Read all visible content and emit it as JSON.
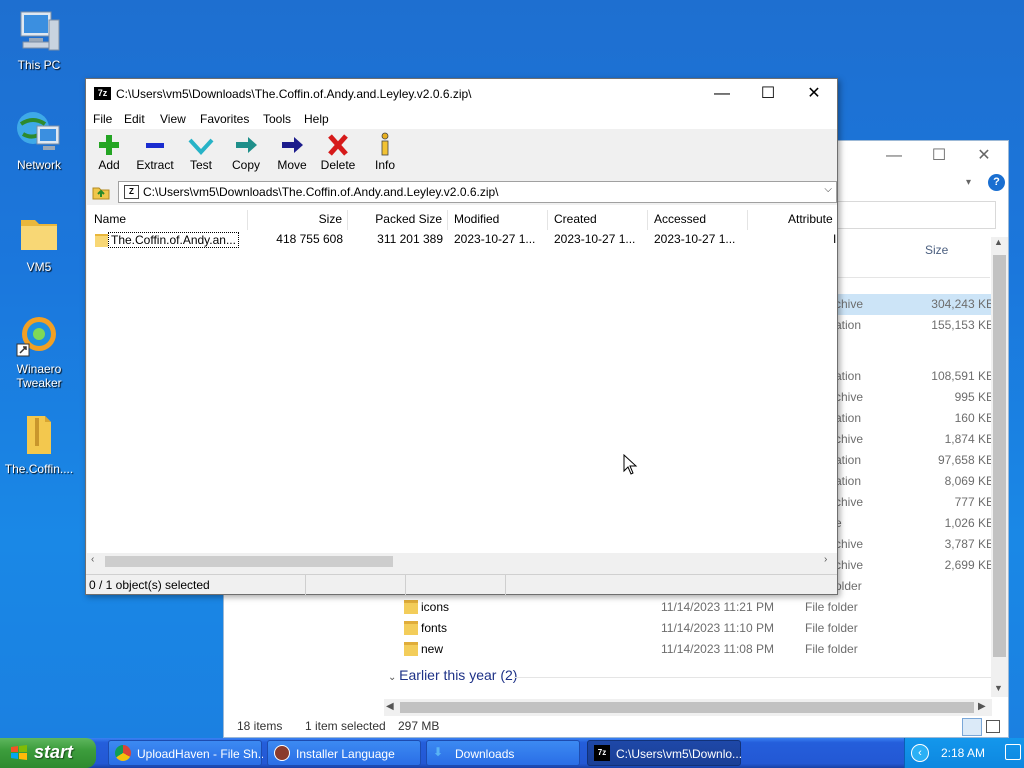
{
  "desktop": {
    "icons": [
      {
        "label": "This PC",
        "icon": "this-pc-icon"
      },
      {
        "label": "Network",
        "icon": "network-icon"
      },
      {
        "label": "VM5",
        "icon": "folder-icon"
      },
      {
        "label": "Winaero Tweaker",
        "icon": "winaero-tweaker-icon"
      },
      {
        "label": "The.Coffin....",
        "icon": "zip-folder-icon"
      }
    ]
  },
  "explorer": {
    "column_size": "Size",
    "rows": [
      {
        "type": "chive",
        "size": "304,243 KB",
        "selected": true
      },
      {
        "type": "ation",
        "size": "155,153 KB"
      },
      {
        "type": "ation",
        "size": "108,591 KB"
      },
      {
        "type": "chive",
        "size": "995 KB"
      },
      {
        "type": "ation",
        "size": "160 KB"
      },
      {
        "type": "chive",
        "size": "1,874 KB"
      },
      {
        "type": "ation",
        "size": "97,658 KB"
      },
      {
        "type": "ation",
        "size": "8,069 KB"
      },
      {
        "type": "chive",
        "size": "777 KB"
      },
      {
        "type": "e",
        "size": "1,026 KB"
      },
      {
        "type": "chive",
        "size": "3,787 KB"
      },
      {
        "type": "chive",
        "size": "2,699 KB"
      },
      {
        "type": "older",
        "size": ""
      }
    ],
    "folders": [
      {
        "name": "icons",
        "date": "11/14/2023 11:21 PM",
        "type": "File folder"
      },
      {
        "name": "fonts",
        "date": "11/14/2023 11:10 PM",
        "type": "File folder"
      },
      {
        "name": "new",
        "date": "11/14/2023 11:08 PM",
        "type": "File folder"
      }
    ],
    "group_header": "Earlier this year (2)",
    "status": {
      "items": "18 items",
      "selected": "1 item selected",
      "size": "297 MB"
    }
  },
  "zip": {
    "title": "C:\\Users\\vm5\\Downloads\\The.Coffin.of.Andy.and.Leyley.v2.0.6.zip\\",
    "menu": [
      "File",
      "Edit",
      "View",
      "Favorites",
      "Tools",
      "Help"
    ],
    "toolbar": [
      {
        "label": "Add",
        "icon": "add-icon"
      },
      {
        "label": "Extract",
        "icon": "extract-icon"
      },
      {
        "label": "Test",
        "icon": "test-icon"
      },
      {
        "label": "Copy",
        "icon": "copy-icon"
      },
      {
        "label": "Move",
        "icon": "move-icon"
      },
      {
        "label": "Delete",
        "icon": "delete-icon"
      },
      {
        "label": "Info",
        "icon": "info-icon"
      }
    ],
    "address": "C:\\Users\\vm5\\Downloads\\The.Coffin.of.Andy.and.Leyley.v2.0.6.zip\\",
    "columns": [
      "Name",
      "Size",
      "Packed Size",
      "Modified",
      "Created",
      "Accessed",
      "Attribute"
    ],
    "rows": [
      {
        "name": "The.Coffin.of.Andy.an...",
        "size": "418 755 608",
        "packed": "311 201 389",
        "modified": "2023-10-27 1...",
        "created": "2023-10-27 1...",
        "accessed": "2023-10-27 1...",
        "attr": "I"
      }
    ],
    "status": "0 / 1 object(s) selected"
  },
  "taskbar": {
    "start": "start",
    "buttons": [
      {
        "label": "UploadHaven - File Sh...",
        "icon": "chrome-icon"
      },
      {
        "label": "Installer Language",
        "icon": "installer-icon"
      },
      {
        "label": "Downloads",
        "icon": "downloads-icon"
      },
      {
        "label": "C:\\Users\\vm5\\Downlo...",
        "icon": "7zip-icon",
        "active": true
      }
    ],
    "clock": "2:18 AM"
  }
}
